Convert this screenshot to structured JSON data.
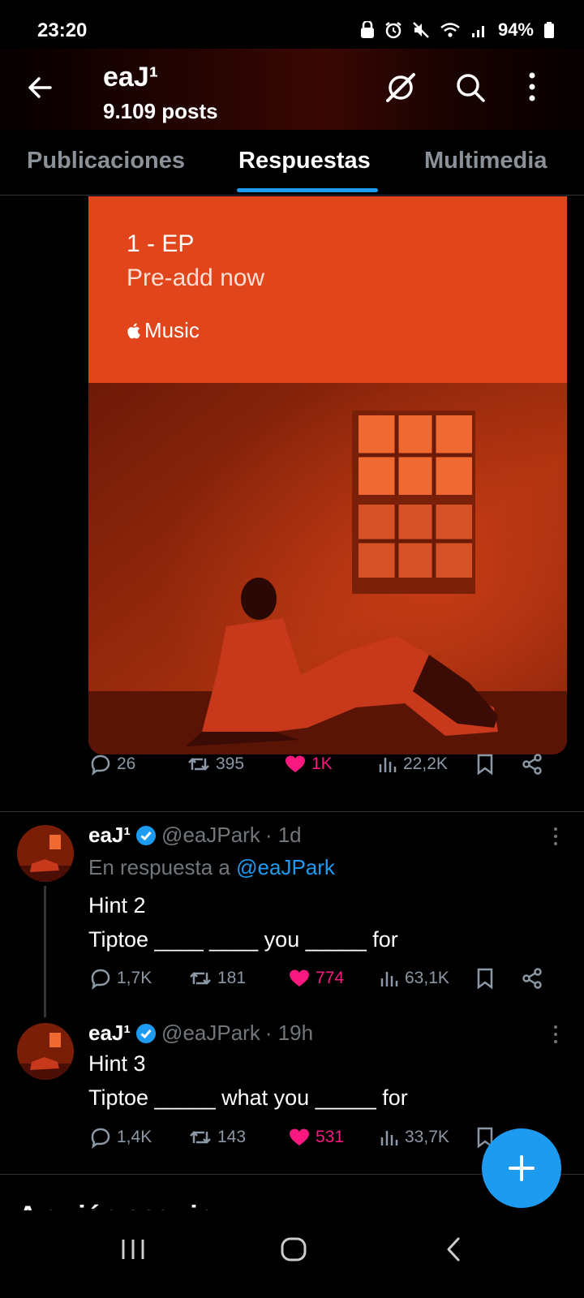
{
  "status_bar": {
    "time": "23:20",
    "battery": "94%"
  },
  "header": {
    "profile_name": "eaJ¹",
    "post_count": "9.109 posts"
  },
  "tabs": [
    {
      "label": "Publicaciones"
    },
    {
      "label": "Respuestas",
      "active": true
    },
    {
      "label": "Multimedia"
    }
  ],
  "media": {
    "promo_title": "1 - EP",
    "promo_subtitle": "Pre-add now",
    "promo_brand": "Music"
  },
  "posts": [
    {
      "stats": {
        "replies": "26",
        "reposts": "395",
        "likes": "1K",
        "views": "22,2K"
      }
    },
    {
      "name": "eaJ¹",
      "handle": "@eaJPark",
      "time": "· 1d",
      "reply_to_label": "En respuesta a",
      "reply_to_handle": "@eaJPark",
      "line1": "Hint 2",
      "line2": "Tiptoe ____ ____ you _____ for",
      "stats": {
        "replies": "1,7K",
        "reposts": "181",
        "likes": "774",
        "views": "63,1K"
      }
    },
    {
      "name": "eaJ¹",
      "handle": "@eaJPark",
      "time": "· 19h",
      "line1": "Hint 3",
      "line2": "Tiptoe _____ what you _____ for",
      "stats": {
        "replies": "1,4K",
        "reposts": "143",
        "likes": "531",
        "views": "33,7K"
      }
    }
  ],
  "who_to_follow": "A quién seguir",
  "colors": {
    "accent": "#1d9bf0",
    "like": "#f91880",
    "promo": "#e0451c",
    "muted": "#71767b"
  }
}
